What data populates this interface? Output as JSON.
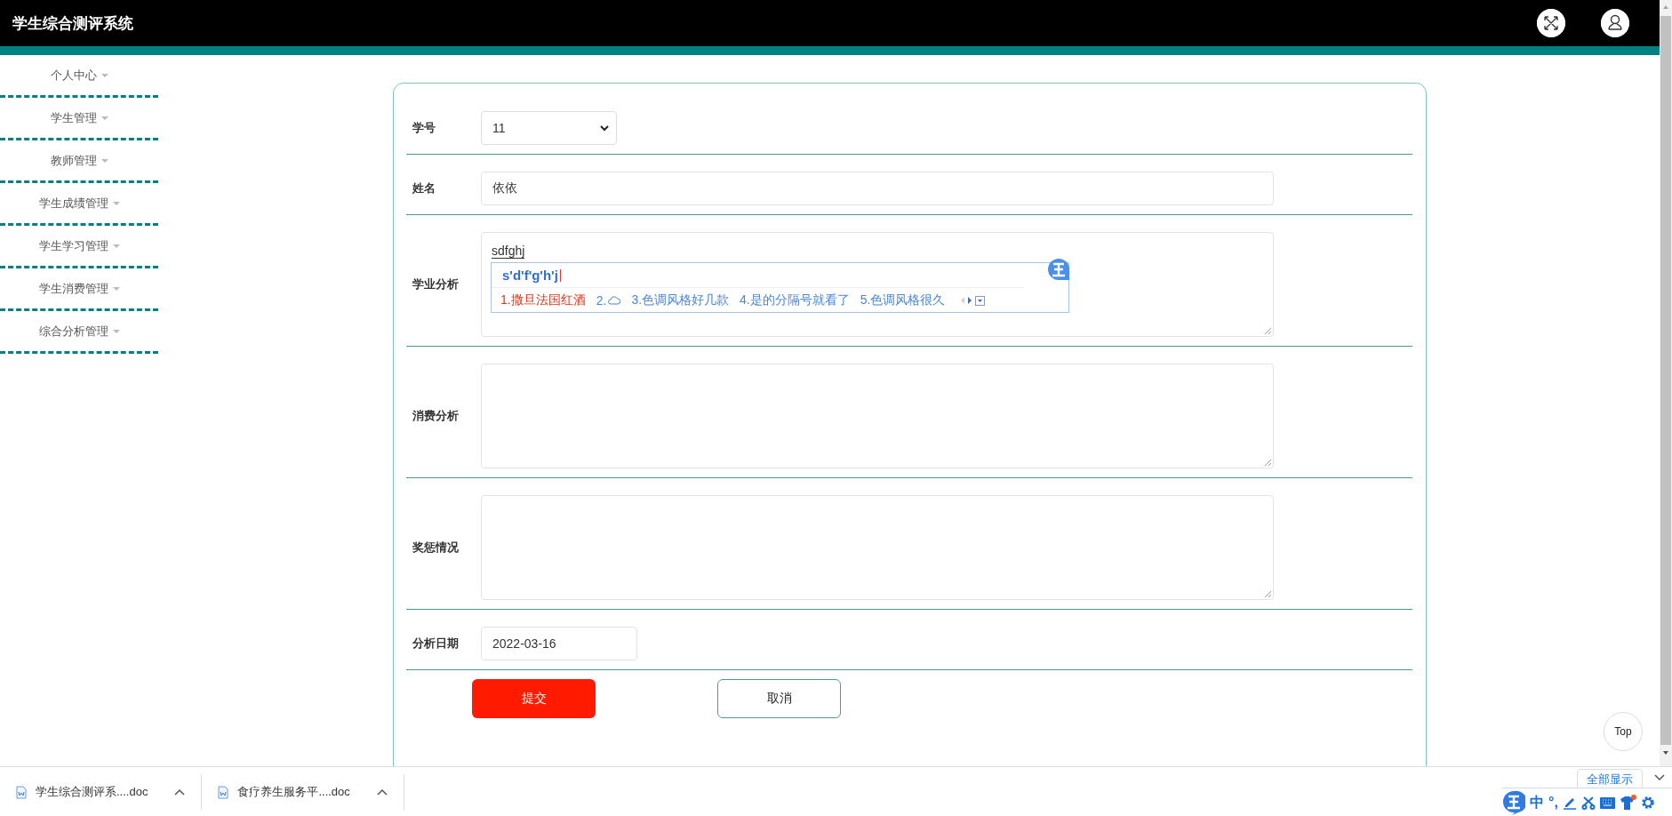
{
  "header": {
    "title": "学生综合测评系统"
  },
  "sidebar": {
    "items": [
      {
        "label": "个人中心"
      },
      {
        "label": "学生管理"
      },
      {
        "label": "教师管理"
      },
      {
        "label": "学生成绩管理"
      },
      {
        "label": "学生学习管理"
      },
      {
        "label": "学生消费管理"
      },
      {
        "label": "综合分析管理"
      }
    ]
  },
  "form": {
    "fields": [
      {
        "kind": "select",
        "label": "学号",
        "value": "11"
      },
      {
        "kind": "text",
        "label": "姓名",
        "value": "依依"
      },
      {
        "kind": "textarea",
        "label": "学业分析",
        "value": "sdfghj"
      },
      {
        "kind": "textarea",
        "label": "消费分析"
      },
      {
        "kind": "textarea",
        "label": "奖惩情况"
      },
      {
        "kind": "date",
        "label": "分析日期",
        "value": "2022-03-16"
      }
    ],
    "buttons": [
      {
        "kind": "primary",
        "label": "提交"
      },
      {
        "kind": "secondary",
        "label": "取消"
      }
    ]
  },
  "back_to_top": "Top",
  "ime_popup": {
    "composition": "s'd'f'g'h'j",
    "candidates": [
      {
        "kind": "text",
        "label": "1.撒旦法国红酒",
        "selected": true
      },
      {
        "kind": "cloud",
        "label": "2.",
        "selected": false
      },
      {
        "kind": "text",
        "label": "3.色调风格好几款",
        "selected": false
      },
      {
        "kind": "text",
        "label": "4.是的分隔号就看了",
        "selected": false
      },
      {
        "kind": "text",
        "label": "5.色调风格很久",
        "selected": false
      }
    ]
  },
  "downloads": {
    "files": [
      {
        "name": "学生综合测评系....doc"
      },
      {
        "name": "食疗养生服务平....doc"
      }
    ],
    "show_all": "全部显示"
  },
  "ime_toolbar": {
    "mode": "中",
    "punctuation": "°,"
  }
}
